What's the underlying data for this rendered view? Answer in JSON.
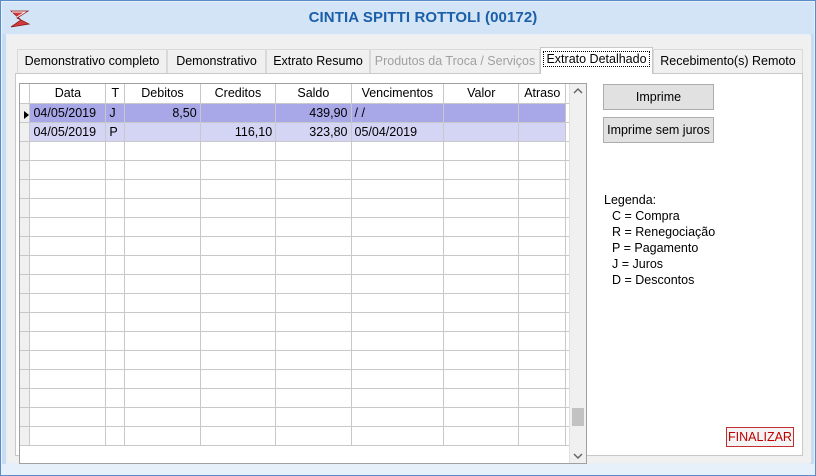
{
  "window": {
    "title": "CINTIA SPITTI ROTTOLI (00172)",
    "accent": "#1a5fa8"
  },
  "tabs": [
    {
      "label": "Demonstrativo completo",
      "state": "normal"
    },
    {
      "label": "Demonstrativo",
      "state": "normal"
    },
    {
      "label": "Extrato Resumo",
      "state": "normal"
    },
    {
      "label": "Produtos da Troca / Serviços",
      "state": "disabled"
    },
    {
      "label": "Extrato Detalhado",
      "state": "active"
    },
    {
      "label": "Recebimento(s) Remoto",
      "state": "normal"
    }
  ],
  "grid": {
    "columns": [
      "Data",
      "T",
      "Debitos",
      "Creditos",
      "Saldo",
      "Vencimentos",
      "Valor",
      "Atraso"
    ],
    "rows": [
      {
        "data": "04/05/2019",
        "t": "J",
        "debitos": "8,50",
        "creditos": "",
        "saldo": "439,90",
        "vencimentos": " /  /",
        "valor": "",
        "atraso": ""
      },
      {
        "data": "04/05/2019",
        "t": "P",
        "debitos": "",
        "creditos": "116,10",
        "saldo": "323,80",
        "vencimentos": "05/04/2019",
        "valor": "",
        "atraso": ""
      }
    ],
    "selected_color": "#a8a8e8",
    "highlight_color": "#d4d4f4"
  },
  "buttons": {
    "imprime": "Imprime",
    "imprime_sem_juros": "Imprime sem juros",
    "finalizar": "FINALIZAR"
  },
  "legend": {
    "title": "Legenda:",
    "items": [
      "C = Compra",
      "R = Renegociação",
      "P = Pagamento",
      "J = Juros",
      "D = Descontos"
    ]
  }
}
